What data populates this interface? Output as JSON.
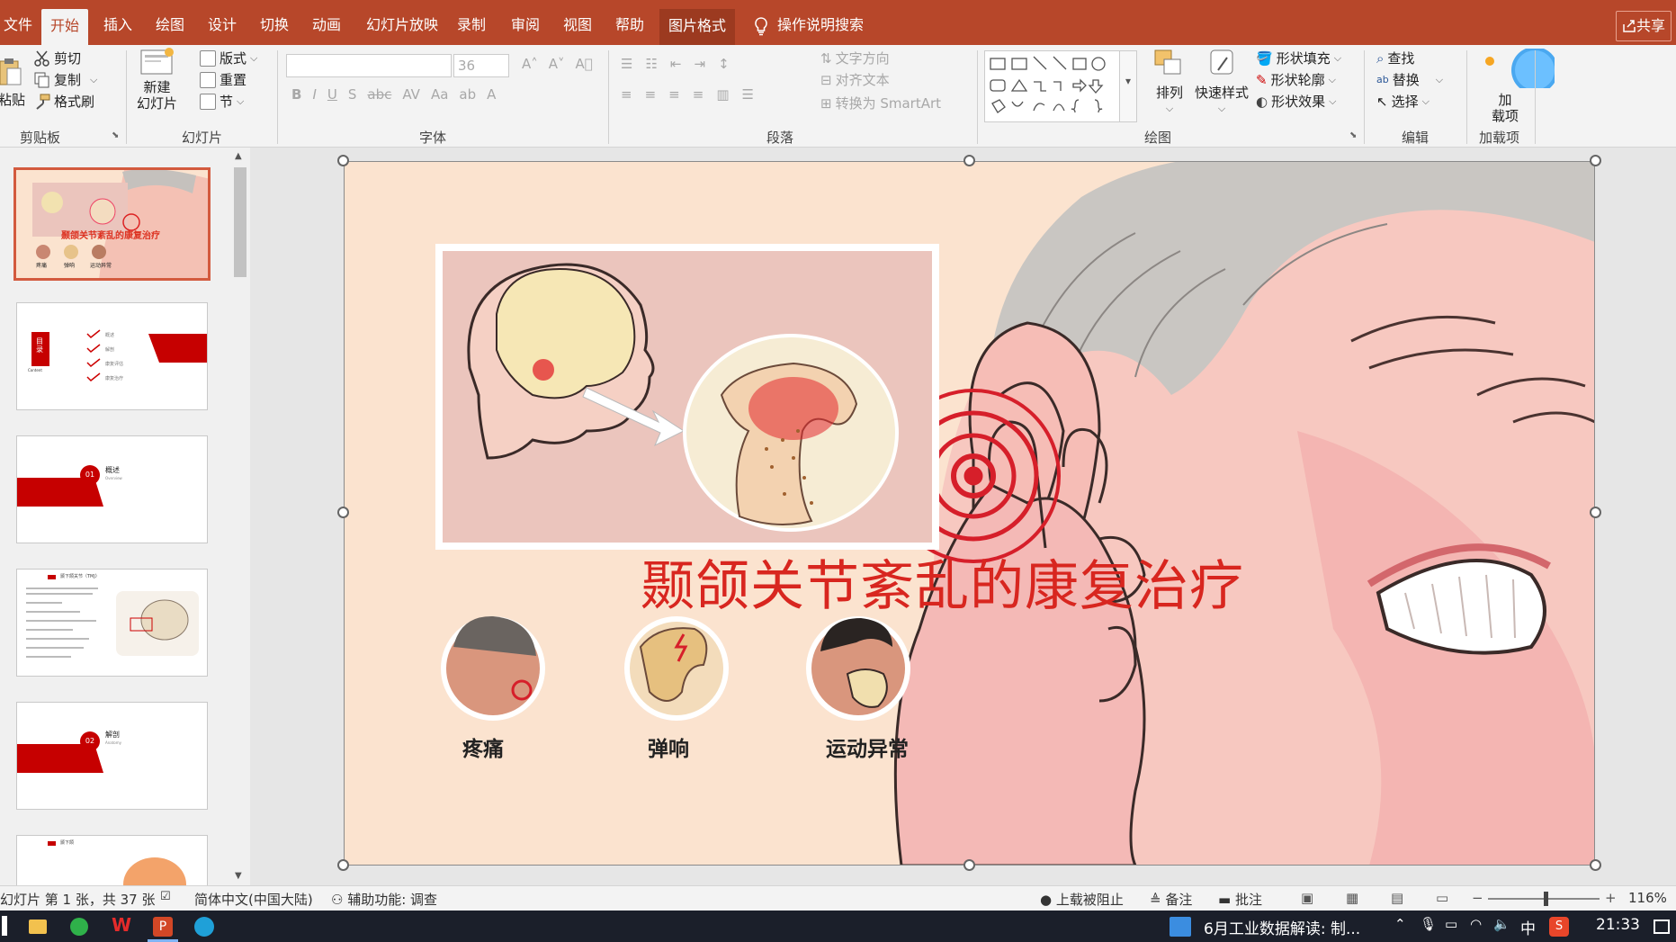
{
  "tabs": [
    "文件",
    "开始",
    "插入",
    "绘图",
    "设计",
    "切换",
    "动画",
    "幻灯片放映",
    "录制",
    "审阅",
    "视图",
    "帮助",
    "图片格式"
  ],
  "search_tab": "操作说明搜索",
  "share": "共享",
  "ribbon": {
    "clipboard": {
      "paste": "粘贴",
      "cut": "剪切",
      "copy": "复制",
      "format_painter": "格式刷",
      "label": "剪贴板"
    },
    "slides": {
      "new_slide": "新建\n幻灯片",
      "layout": "版式",
      "reset": "重置",
      "section": "节",
      "label": "幻灯片"
    },
    "font": {
      "size": "36",
      "label": "字体"
    },
    "paragraph": {
      "text_direction": "文字方向",
      "align_text": "对齐文本",
      "smartart": "转换为 SmartArt",
      "label": "段落"
    },
    "drawing": {
      "arrange": "排列",
      "quick_styles": "快速样式",
      "shape_fill": "形状填充",
      "shape_outline": "形状轮廓",
      "shape_effects": "形状效果",
      "label": "绘图"
    },
    "editing": {
      "find": "查找",
      "replace": "替换",
      "select": "选择",
      "label": "编辑"
    },
    "addins": {
      "add": "加\n载项",
      "label": "加载项"
    }
  },
  "slide": {
    "title": "颞颌关节紊乱的康复治疗",
    "symptoms": [
      "疼痛",
      "弹响",
      "运动异常"
    ]
  },
  "thumbs": [
    {
      "title": "颞颌关节紊乱的康复治疗",
      "labels": [
        "疼痛",
        "弹响",
        "运动异常"
      ]
    },
    {
      "vert": "目录",
      "sub": "Content",
      "items": [
        "概述",
        "解剖",
        "康复评估",
        "康复治疗"
      ]
    },
    {
      "num": "01",
      "title": "概述",
      "sub": "Overview"
    },
    {
      "title": "颞下颌关节（TMJ）"
    },
    {
      "num": "02",
      "title": "解剖",
      "sub": "Anatomy"
    },
    {
      "title": "颞下颌"
    }
  ],
  "status": {
    "slide_info": "幻灯片 第 1 张，共 37 张",
    "language": "简体中文(中国大陆)",
    "accessibility": "辅助功能: 调查",
    "upload": "上载被阻止",
    "notes": "备注",
    "comments": "批注",
    "zoom": "116%"
  },
  "taskbar": {
    "news": "6月工业数据解读: 制...",
    "ime": "中",
    "time": "21:33"
  }
}
